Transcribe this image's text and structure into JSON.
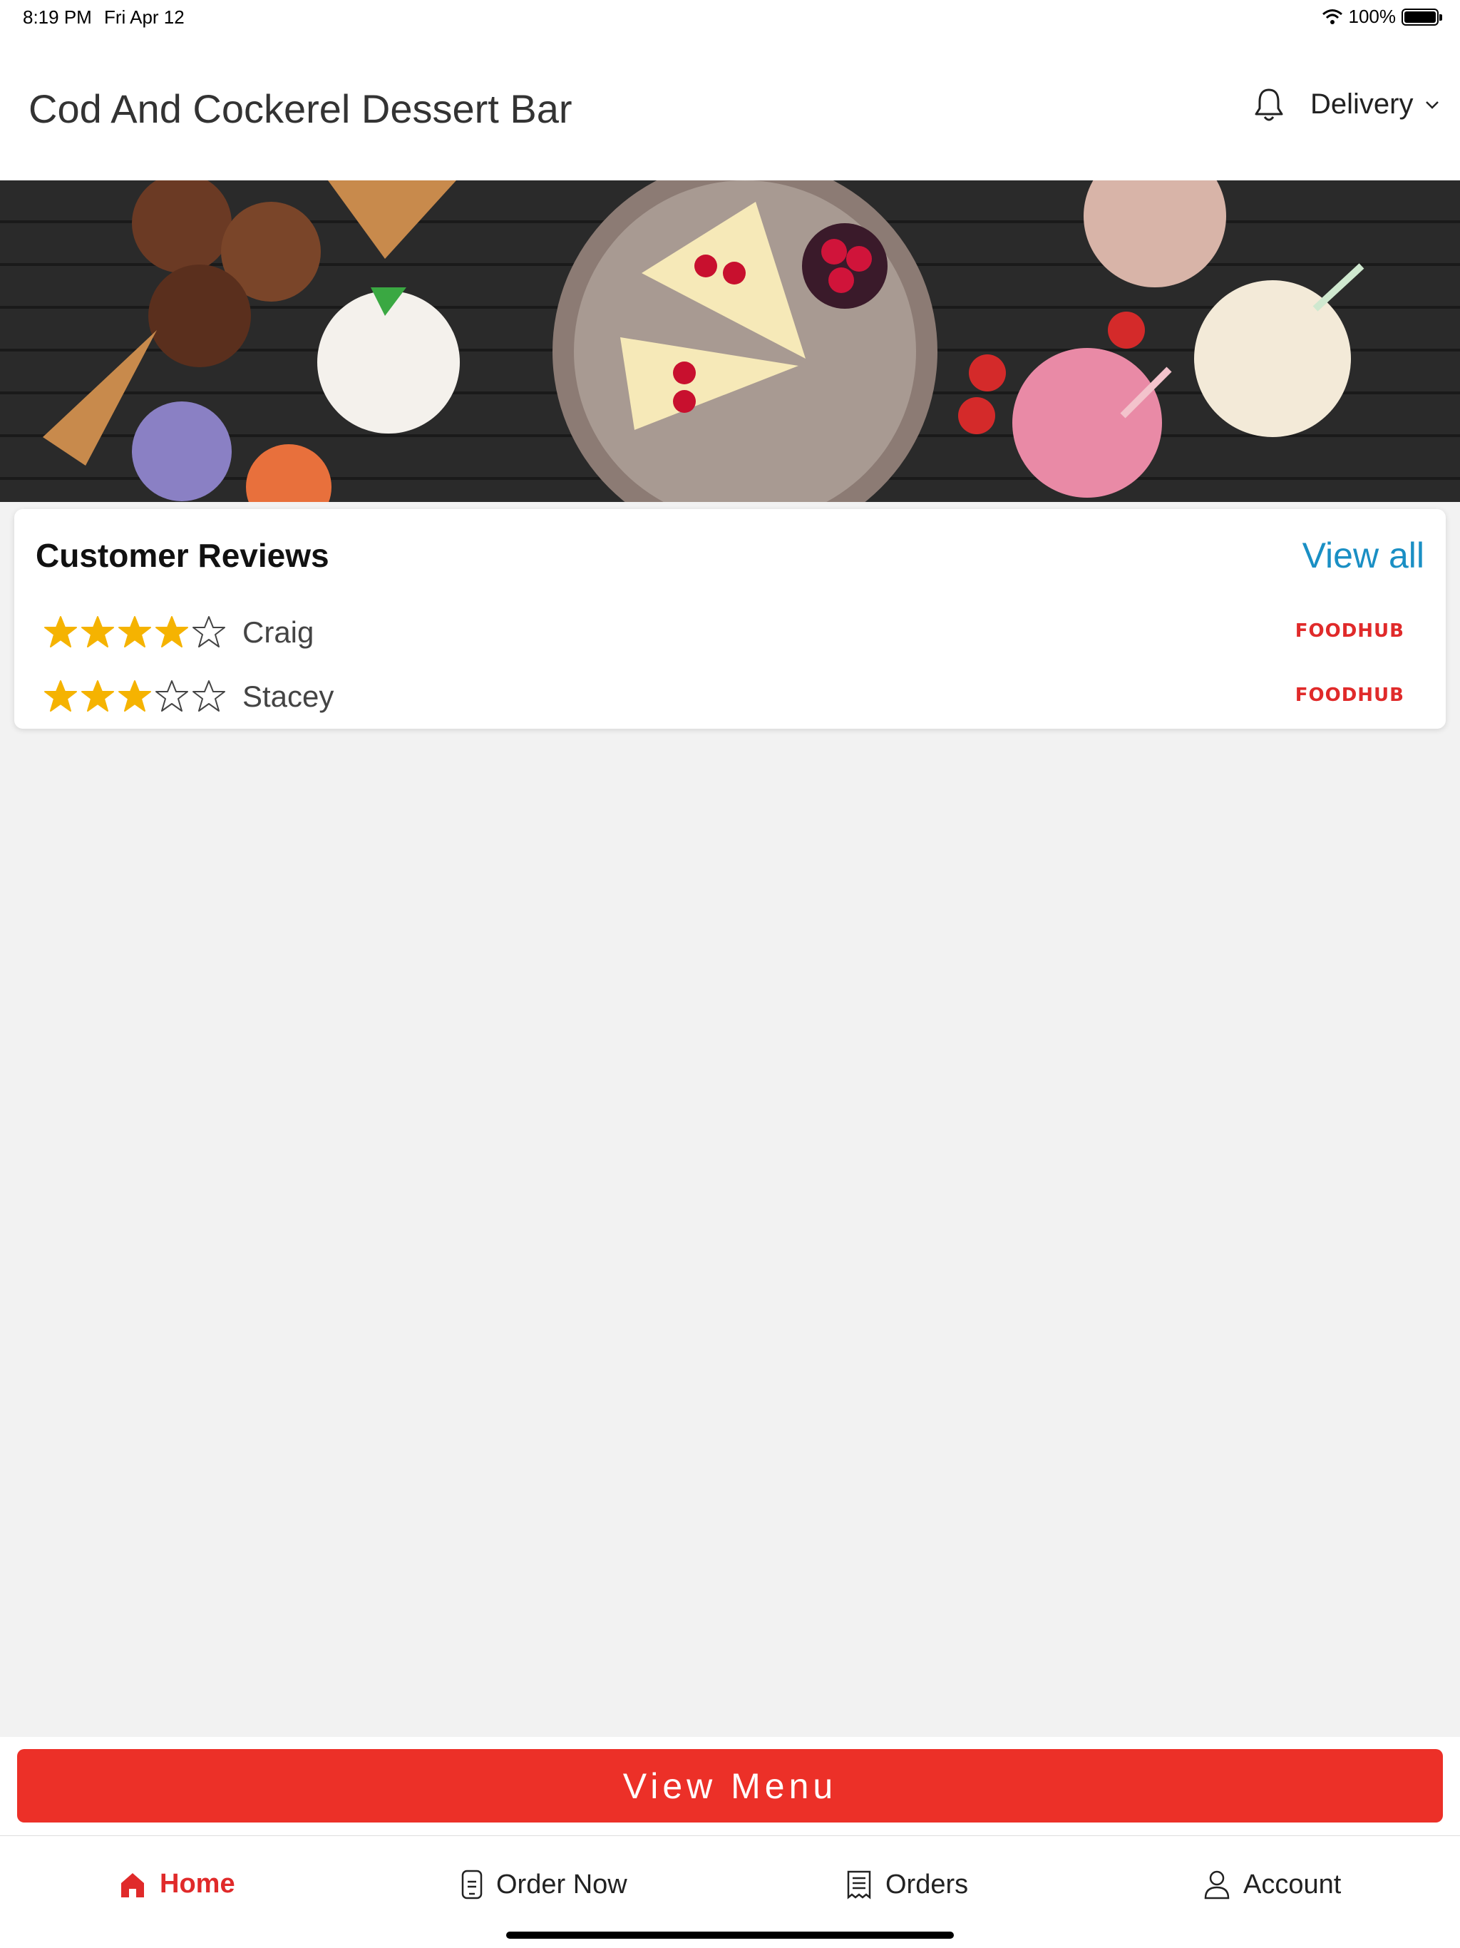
{
  "status": {
    "time": "8:19 PM",
    "date": "Fri Apr 12",
    "battery": "100%"
  },
  "header": {
    "title": "Cod And Cockerel Dessert Bar",
    "delivery_label": "Delivery"
  },
  "reviews": {
    "title": "Customer Reviews",
    "view_all": "View all",
    "items": [
      {
        "name": "Craig",
        "rating": 4,
        "source": "FOODHUB"
      },
      {
        "name": "Stacey",
        "rating": 3,
        "source": "FOODHUB"
      }
    ]
  },
  "view_menu": "View Menu",
  "tabs": [
    {
      "label": "Home",
      "icon": "home-icon",
      "active": true
    },
    {
      "label": "Order Now",
      "icon": "phone-order-icon",
      "active": false
    },
    {
      "label": "Orders",
      "icon": "receipt-icon",
      "active": false
    },
    {
      "label": "Account",
      "icon": "user-icon",
      "active": false
    }
  ],
  "colors": {
    "accent": "#ec3028",
    "link": "#1a8fc4",
    "star": "#f5b301"
  }
}
